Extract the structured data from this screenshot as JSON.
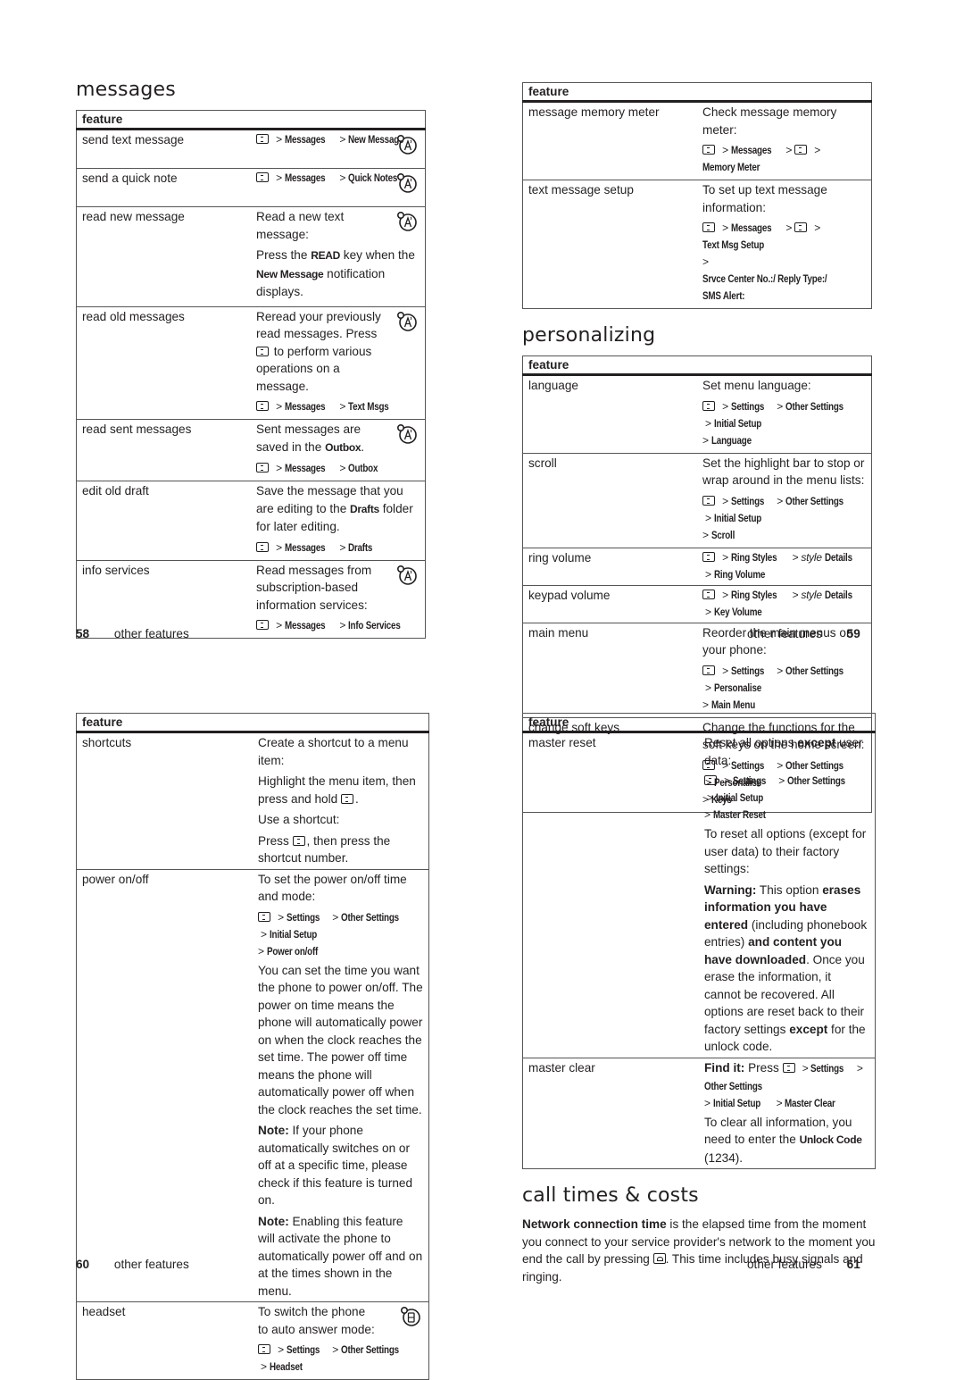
{
  "menu_key_icon": "menu-key-icon",
  "network_icon": "network-dependent-feature-icon",
  "headset_icon": "headset-accessory-icon",
  "end_key_icon": "end-call-key-icon",
  "separator": ">",
  "page58": {
    "title": "messages",
    "table_header": "feature",
    "rows": [
      {
        "feature": "send text message",
        "path": [
          "Messages",
          "New Message"
        ],
        "icon": true
      },
      {
        "feature": "send a quick note",
        "path": [
          "Messages",
          "Quick Notes"
        ],
        "icon": true
      },
      {
        "feature": "read new message",
        "text1": "Read a new text message:",
        "text2a": "Press the ",
        "text2b": "READ",
        "text2c": " key when the ",
        "text2d": "New Message",
        "text2e": " notification displays.",
        "icon": true
      },
      {
        "feature": "read old messages",
        "text1a": "Reread your previously read messages. Press ",
        "text1b": " to perform various operations on a message.",
        "path": [
          "Messages",
          "Text Msgs"
        ],
        "icon": true
      },
      {
        "feature": "read sent messages",
        "text1a": "Sent messages are saved in the ",
        "text1b": "Outbox",
        "text1c": ".",
        "path": [
          "Messages",
          "Outbox"
        ],
        "icon": true
      },
      {
        "feature": "edit old draft",
        "text1a": "Save the message that you are editing to the ",
        "text1b": "Drafts",
        "text1c": " folder for later editing.",
        "path": [
          "Messages",
          "Drafts"
        ],
        "icon": false
      },
      {
        "feature": "info services",
        "text1": "Read messages from subscription-based information services:",
        "path": [
          "Messages",
          "Info Services"
        ],
        "icon": true
      }
    ],
    "footer": {
      "number": "58",
      "label": "other features"
    }
  },
  "page59": {
    "rows_top": [
      {
        "feature": "message memory meter",
        "text1": "Check message memory meter:",
        "path": [
          "Messages",
          "MENU",
          "Memory Meter"
        ]
      },
      {
        "feature": "text message setup",
        "text1": "To set up text message information:",
        "path": [
          "Messages",
          "MENU",
          "Text Msg Setup"
        ],
        "path2": "Srvce Center No.:/ Reply Type:/ SMS Alert:"
      }
    ],
    "table_header": "feature",
    "title": "personalizing",
    "rows": [
      {
        "feature": "language",
        "text1": "Set menu language:",
        "path": [
          "Settings",
          "Other Settings",
          "Initial Setup"
        ],
        "path2": "Language"
      },
      {
        "feature": "scroll",
        "text1": "Set the highlight bar to stop or wrap around in the menu lists:",
        "path": [
          "Settings",
          "Other Settings",
          "Initial Setup"
        ],
        "path2": "Scroll"
      },
      {
        "feature": "ring volume",
        "path_a": "Ring Styles",
        "path_style": "style",
        "path_b": "Details",
        "path_c": "Ring Volume"
      },
      {
        "feature": "keypad volume",
        "path_a": "Ring Styles",
        "path_style": "style",
        "path_b": "Details",
        "path_c": "Key Volume"
      },
      {
        "feature": "main menu",
        "text1": "Reorder the main menus on your phone:",
        "path": [
          "Settings",
          "Other Settings",
          "Personalise"
        ],
        "path2": "Main Menu"
      },
      {
        "feature": "change soft keys",
        "text1": "Change the functions for the soft keys on the home screen:",
        "path": [
          "Settings",
          "Other Settings",
          "Personalise"
        ],
        "path2": "Keys"
      }
    ],
    "footer": {
      "number": "59",
      "label": "other features"
    }
  },
  "page60": {
    "table_header": "feature",
    "rows": [
      {
        "feature": "shortcuts",
        "text1": "Create a shortcut to a menu item:",
        "text2a": "Highlight the menu item, then press and hold ",
        "text2b": ".",
        "text3": "Use a shortcut:",
        "text4a": "Press ",
        "text4b": ", then press the shortcut number."
      },
      {
        "feature": "power on/off",
        "text1": "To set the power on/off time and mode:",
        "path": [
          "Settings",
          "Other Settings",
          "Initial Setup"
        ],
        "path2": "Power on/off",
        "text2": "You can set the time you want the phone to power on/off. The power on time means the phone will automatically power on when the clock reaches the set time. The power off time means the phone will automatically power off when the clock reaches the set time.",
        "note1_label": "Note:",
        "note1": " If your phone automatically switches on or off at a specific time, please check if this feature is turned on.",
        "note2_label": "Note:",
        "note2": " Enabling this feature will activate the phone to automatically power off and on at the times shown in the menu."
      },
      {
        "feature": "headset",
        "text1": "To switch the phone to auto answer mode:",
        "path": [
          "Settings",
          "Other Settings",
          "Headset"
        ],
        "icon": true
      }
    ],
    "footer": {
      "number": "60",
      "label": "other features"
    }
  },
  "page61": {
    "table_header": "feature",
    "rows": [
      {
        "feature": "master reset",
        "text1a": "Reset all options ",
        "text1b": "except",
        "text1c": " user data:",
        "path": [
          "Settings",
          "Other Settings",
          "Initial Setup"
        ],
        "path2": "Master Reset",
        "text2": "To reset all options (except for user data) to their factory settings:",
        "warn_label": "Warning:",
        "warn_a": " This option ",
        "warn_b": "erases information you have entered",
        "warn_c": " (including phonebook entries) ",
        "warn_d": "and content you have downloaded",
        "warn_e": ". Once you erase the information, it cannot be recovered. All options are reset back to their factory settings ",
        "warn_f": "except",
        "warn_g": " for the unlock code."
      },
      {
        "feature": "master clear",
        "find_label": "Find it:",
        "find_press": " Press ",
        "path": [
          "Settings",
          "Other Settings"
        ],
        "path2a": "Initial Setup",
        "path2b": "Master Clear",
        "text2a": "To clear all information, you need to enter the ",
        "text2b": "Unlock Code",
        "text2c": " (1234)."
      }
    ],
    "title": "call times & costs",
    "body_bold": "Network connection time",
    "body_a": " is the elapsed time from the moment you connect to your service provider's network to the moment you end the call by pressing ",
    "body_b": ". This time includes busy signals and ringing.",
    "footer": {
      "number": "61",
      "label": "other features"
    }
  }
}
